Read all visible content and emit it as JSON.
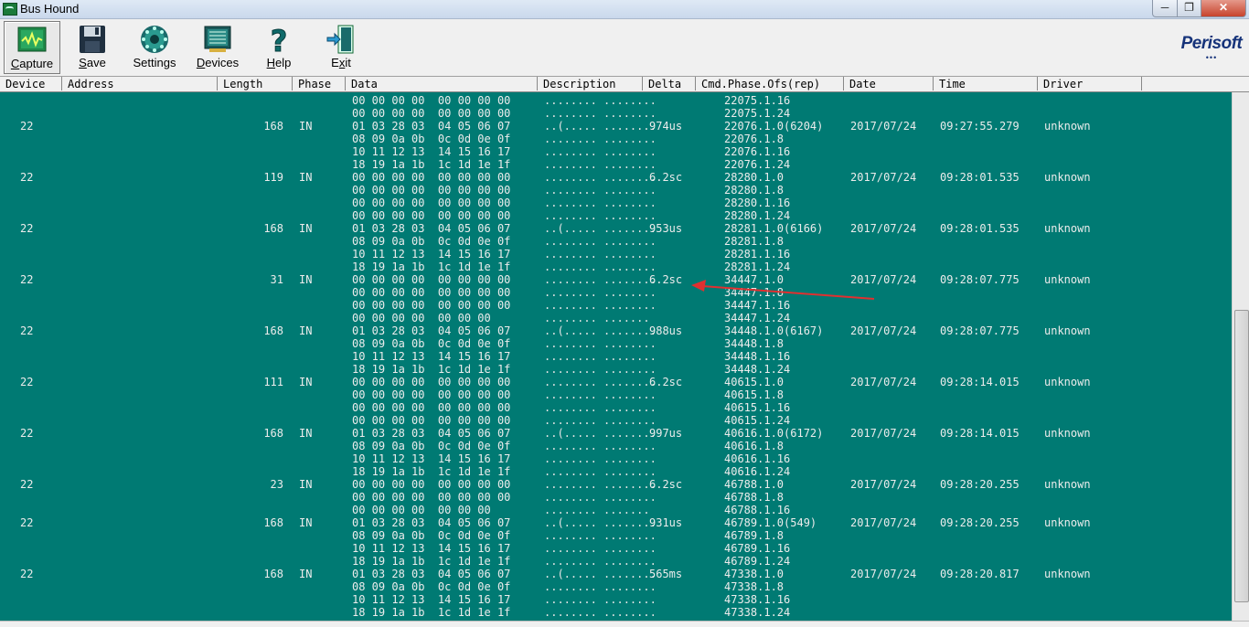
{
  "window": {
    "title": "Bus Hound"
  },
  "toolbar": {
    "buttons": [
      {
        "label": "Capture",
        "underline": "C"
      },
      {
        "label": "Save",
        "underline": "S"
      },
      {
        "label": "Settings",
        "underline": ""
      },
      {
        "label": "Devices",
        "underline": "D"
      },
      {
        "label": "Help",
        "underline": "H"
      },
      {
        "label": "Exit",
        "underline": "x"
      }
    ],
    "logo": "Perisoft",
    "logo_dots": "•••"
  },
  "columns": [
    "Device",
    "Address",
    "Length",
    "Phase",
    "Data",
    "Description",
    "Delta",
    "Cmd.Phase.Ofs(rep)",
    "Date",
    "Time",
    "Driver"
  ],
  "colors": {
    "grid_bg": "#007a73",
    "grid_text": "#ececec",
    "arrow": "#e03030"
  },
  "rows": [
    {
      "device": "",
      "length": "",
      "phase": "",
      "data": "00 00 00 00  00 00 00 00",
      "desc": "........ ........",
      "delta": "",
      "cmd": "22075.1.16",
      "date": "",
      "time": "",
      "driver": ""
    },
    {
      "device": "",
      "length": "",
      "phase": "",
      "data": "00 00 00 00  00 00 00 00",
      "desc": "........ ........",
      "delta": "",
      "cmd": "22075.1.24",
      "date": "",
      "time": "",
      "driver": ""
    },
    {
      "device": "22",
      "length": "168",
      "phase": "IN",
      "data": "01 03 28 03  04 05 06 07",
      "desc": "..(..... ........",
      "delta": "974us",
      "cmd": "22076.1.0(6204)",
      "date": "2017/07/24",
      "time": "09:27:55.279",
      "driver": "unknown"
    },
    {
      "device": "",
      "length": "",
      "phase": "",
      "data": "08 09 0a 0b  0c 0d 0e 0f",
      "desc": "........ ........",
      "delta": "",
      "cmd": "22076.1.8",
      "date": "",
      "time": "",
      "driver": ""
    },
    {
      "device": "",
      "length": "",
      "phase": "",
      "data": "10 11 12 13  14 15 16 17",
      "desc": "........ ........",
      "delta": "",
      "cmd": "22076.1.16",
      "date": "",
      "time": "",
      "driver": ""
    },
    {
      "device": "",
      "length": "",
      "phase": "",
      "data": "18 19 1a 1b  1c 1d 1e 1f",
      "desc": "........ ........",
      "delta": "",
      "cmd": "22076.1.24",
      "date": "",
      "time": "",
      "driver": ""
    },
    {
      "device": "22",
      "length": "119",
      "phase": "IN",
      "data": "00 00 00 00  00 00 00 00",
      "desc": "........ ........",
      "delta": "6.2sc",
      "cmd": "28280.1.0",
      "date": "2017/07/24",
      "time": "09:28:01.535",
      "driver": "unknown"
    },
    {
      "device": "",
      "length": "",
      "phase": "",
      "data": "00 00 00 00  00 00 00 00",
      "desc": "........ ........",
      "delta": "",
      "cmd": "28280.1.8",
      "date": "",
      "time": "",
      "driver": ""
    },
    {
      "device": "",
      "length": "",
      "phase": "",
      "data": "00 00 00 00  00 00 00 00",
      "desc": "........ ........",
      "delta": "",
      "cmd": "28280.1.16",
      "date": "",
      "time": "",
      "driver": ""
    },
    {
      "device": "",
      "length": "",
      "phase": "",
      "data": "00 00 00 00  00 00 00 00",
      "desc": "........ ........",
      "delta": "",
      "cmd": "28280.1.24",
      "date": "",
      "time": "",
      "driver": ""
    },
    {
      "device": "22",
      "length": "168",
      "phase": "IN",
      "data": "01 03 28 03  04 05 06 07",
      "desc": "..(..... ........",
      "delta": "953us",
      "cmd": "28281.1.0(6166)",
      "date": "2017/07/24",
      "time": "09:28:01.535",
      "driver": "unknown"
    },
    {
      "device": "",
      "length": "",
      "phase": "",
      "data": "08 09 0a 0b  0c 0d 0e 0f",
      "desc": "........ ........",
      "delta": "",
      "cmd": "28281.1.8",
      "date": "",
      "time": "",
      "driver": ""
    },
    {
      "device": "",
      "length": "",
      "phase": "",
      "data": "10 11 12 13  14 15 16 17",
      "desc": "........ ........",
      "delta": "",
      "cmd": "28281.1.16",
      "date": "",
      "time": "",
      "driver": ""
    },
    {
      "device": "",
      "length": "",
      "phase": "",
      "data": "18 19 1a 1b  1c 1d 1e 1f",
      "desc": "........ ........",
      "delta": "",
      "cmd": "28281.1.24",
      "date": "",
      "time": "",
      "driver": ""
    },
    {
      "device": "22",
      "length": "31",
      "phase": "IN",
      "data": "00 00 00 00  00 00 00 00",
      "desc": "........ ........",
      "delta": "6.2sc",
      "cmd": "34447.1.0",
      "date": "2017/07/24",
      "time": "09:28:07.775",
      "driver": "unknown"
    },
    {
      "device": "",
      "length": "",
      "phase": "",
      "data": "00 00 00 00  00 00 00 00",
      "desc": "........ ........",
      "delta": "",
      "cmd": "34447.1.8",
      "date": "",
      "time": "",
      "driver": ""
    },
    {
      "device": "",
      "length": "",
      "phase": "",
      "data": "00 00 00 00  00 00 00 00",
      "desc": "........ ........",
      "delta": "",
      "cmd": "34447.1.16",
      "date": "",
      "time": "",
      "driver": ""
    },
    {
      "device": "",
      "length": "",
      "phase": "",
      "data": "00 00 00 00  00 00 00",
      "desc": "........ .......",
      "delta": "",
      "cmd": "34447.1.24",
      "date": "",
      "time": "",
      "driver": ""
    },
    {
      "device": "22",
      "length": "168",
      "phase": "IN",
      "data": "01 03 28 03  04 05 06 07",
      "desc": "..(..... ........",
      "delta": "988us",
      "cmd": "34448.1.0(6167)",
      "date": "2017/07/24",
      "time": "09:28:07.775",
      "driver": "unknown"
    },
    {
      "device": "",
      "length": "",
      "phase": "",
      "data": "08 09 0a 0b  0c 0d 0e 0f",
      "desc": "........ ........",
      "delta": "",
      "cmd": "34448.1.8",
      "date": "",
      "time": "",
      "driver": ""
    },
    {
      "device": "",
      "length": "",
      "phase": "",
      "data": "10 11 12 13  14 15 16 17",
      "desc": "........ ........",
      "delta": "",
      "cmd": "34448.1.16",
      "date": "",
      "time": "",
      "driver": ""
    },
    {
      "device": "",
      "length": "",
      "phase": "",
      "data": "18 19 1a 1b  1c 1d 1e 1f",
      "desc": "........ ........",
      "delta": "",
      "cmd": "34448.1.24",
      "date": "",
      "time": "",
      "driver": ""
    },
    {
      "device": "22",
      "length": "111",
      "phase": "IN",
      "data": "00 00 00 00  00 00 00 00",
      "desc": "........ ........",
      "delta": "6.2sc",
      "cmd": "40615.1.0",
      "date": "2017/07/24",
      "time": "09:28:14.015",
      "driver": "unknown"
    },
    {
      "device": "",
      "length": "",
      "phase": "",
      "data": "00 00 00 00  00 00 00 00",
      "desc": "........ ........",
      "delta": "",
      "cmd": "40615.1.8",
      "date": "",
      "time": "",
      "driver": ""
    },
    {
      "device": "",
      "length": "",
      "phase": "",
      "data": "00 00 00 00  00 00 00 00",
      "desc": "........ ........",
      "delta": "",
      "cmd": "40615.1.16",
      "date": "",
      "time": "",
      "driver": ""
    },
    {
      "device": "",
      "length": "",
      "phase": "",
      "data": "00 00 00 00  00 00 00 00",
      "desc": "........ ........",
      "delta": "",
      "cmd": "40615.1.24",
      "date": "",
      "time": "",
      "driver": ""
    },
    {
      "device": "22",
      "length": "168",
      "phase": "IN",
      "data": "01 03 28 03  04 05 06 07",
      "desc": "..(..... ........",
      "delta": "997us",
      "cmd": "40616.1.0(6172)",
      "date": "2017/07/24",
      "time": "09:28:14.015",
      "driver": "unknown"
    },
    {
      "device": "",
      "length": "",
      "phase": "",
      "data": "08 09 0a 0b  0c 0d 0e 0f",
      "desc": "........ ........",
      "delta": "",
      "cmd": "40616.1.8",
      "date": "",
      "time": "",
      "driver": ""
    },
    {
      "device": "",
      "length": "",
      "phase": "",
      "data": "10 11 12 13  14 15 16 17",
      "desc": "........ ........",
      "delta": "",
      "cmd": "40616.1.16",
      "date": "",
      "time": "",
      "driver": ""
    },
    {
      "device": "",
      "length": "",
      "phase": "",
      "data": "18 19 1a 1b  1c 1d 1e 1f",
      "desc": "........ ........",
      "delta": "",
      "cmd": "40616.1.24",
      "date": "",
      "time": "",
      "driver": ""
    },
    {
      "device": "22",
      "length": "23",
      "phase": "IN",
      "data": "00 00 00 00  00 00 00 00",
      "desc": "........ ........",
      "delta": "6.2sc",
      "cmd": "46788.1.0",
      "date": "2017/07/24",
      "time": "09:28:20.255",
      "driver": "unknown"
    },
    {
      "device": "",
      "length": "",
      "phase": "",
      "data": "00 00 00 00  00 00 00 00",
      "desc": "........ ........",
      "delta": "",
      "cmd": "46788.1.8",
      "date": "",
      "time": "",
      "driver": ""
    },
    {
      "device": "",
      "length": "",
      "phase": "",
      "data": "00 00 00 00  00 00 00",
      "desc": "........ .......",
      "delta": "",
      "cmd": "46788.1.16",
      "date": "",
      "time": "",
      "driver": ""
    },
    {
      "device": "22",
      "length": "168",
      "phase": "IN",
      "data": "01 03 28 03  04 05 06 07",
      "desc": "..(..... ........",
      "delta": "931us",
      "cmd": "46789.1.0(549)",
      "date": "2017/07/24",
      "time": "09:28:20.255",
      "driver": "unknown"
    },
    {
      "device": "",
      "length": "",
      "phase": "",
      "data": "08 09 0a 0b  0c 0d 0e 0f",
      "desc": "........ ........",
      "delta": "",
      "cmd": "46789.1.8",
      "date": "",
      "time": "",
      "driver": ""
    },
    {
      "device": "",
      "length": "",
      "phase": "",
      "data": "10 11 12 13  14 15 16 17",
      "desc": "........ ........",
      "delta": "",
      "cmd": "46789.1.16",
      "date": "",
      "time": "",
      "driver": ""
    },
    {
      "device": "",
      "length": "",
      "phase": "",
      "data": "18 19 1a 1b  1c 1d 1e 1f",
      "desc": "........ ........",
      "delta": "",
      "cmd": "46789.1.24",
      "date": "",
      "time": "",
      "driver": ""
    },
    {
      "device": "22",
      "length": "168",
      "phase": "IN",
      "data": "01 03 28 03  04 05 06 07",
      "desc": "..(..... ........",
      "delta": "565ms",
      "cmd": "47338.1.0",
      "date": "2017/07/24",
      "time": "09:28:20.817",
      "driver": "unknown"
    },
    {
      "device": "",
      "length": "",
      "phase": "",
      "data": "08 09 0a 0b  0c 0d 0e 0f",
      "desc": "........ ........",
      "delta": "",
      "cmd": "47338.1.8",
      "date": "",
      "time": "",
      "driver": ""
    },
    {
      "device": "",
      "length": "",
      "phase": "",
      "data": "10 11 12 13  14 15 16 17",
      "desc": "........ ........",
      "delta": "",
      "cmd": "47338.1.16",
      "date": "",
      "time": "",
      "driver": ""
    },
    {
      "device": "",
      "length": "",
      "phase": "",
      "data": "18 19 1a 1b  1c 1d 1e 1f",
      "desc": "........ ........",
      "delta": "",
      "cmd": "47338.1.24",
      "date": "",
      "time": "",
      "driver": ""
    }
  ]
}
